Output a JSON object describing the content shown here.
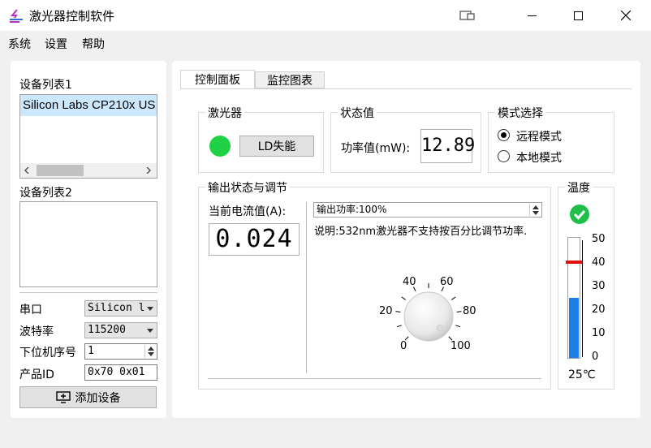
{
  "window": {
    "title": "激光器控制软件",
    "close_glyph": "✕",
    "maximize_glyph": "☐",
    "minimize_glyph": "—"
  },
  "menu": [
    "系统",
    "设置",
    "帮助"
  ],
  "left": {
    "device_list1_label": "设备列表1",
    "device_list1_items": [
      "Silicon Labs CP210x US"
    ],
    "device_list2_label": "设备列表2",
    "port_label": "串口",
    "port_value": "Silicon l",
    "baud_label": "波特率",
    "baud_value": "115200",
    "slave_label": "下位机序号",
    "slave_value": "1",
    "product_label": "产品ID",
    "product_value": "0x70 0x01",
    "add_device_label": "添加设备"
  },
  "tabs": [
    "控制面板",
    "监控图表"
  ],
  "laser_group": {
    "title": "激光器",
    "status_color": "#1fd145",
    "button_label": "LD失能"
  },
  "status_group": {
    "title": "状态值",
    "power_label": "功率值(mW):",
    "power_value": "12.89"
  },
  "mode_group": {
    "title": "模式选择",
    "remote_label": "远程模式",
    "local_label": "本地模式",
    "selected": "remote"
  },
  "output_group": {
    "title": "输出状态与调节",
    "current_label": "当前电流值(A):",
    "current_value": "0.024",
    "output_power_value": "输出功率:100%",
    "note": "说明:532nm激光器不支持按百分比调节功率.",
    "dial_labels": [
      "0",
      "20",
      "40",
      "60",
      "80",
      "100"
    ],
    "dial_level": 100
  },
  "temp_group": {
    "title": "温度",
    "ok_color": "#1fbf4a",
    "scale": [
      "50",
      "40",
      "30",
      "20",
      "10",
      "0"
    ],
    "marker_value": 40,
    "fill_value": 25,
    "readout": "25℃",
    "fill_color": "#1e7de6",
    "marker_color": "#e01010"
  }
}
